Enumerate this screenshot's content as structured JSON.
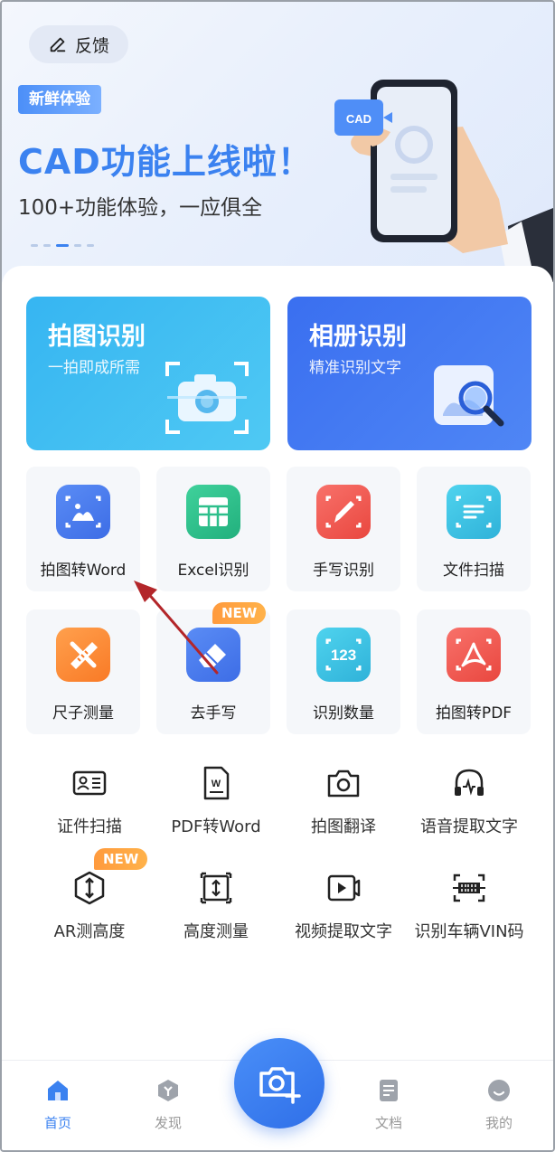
{
  "banner": {
    "feedback_label": "反馈",
    "tag": "新鲜体验",
    "title": "CAD功能上线啦！",
    "subtitle": "100+功能体验，一应俱全",
    "phone_badge": "CAD"
  },
  "big_cards": [
    {
      "title": "拍图识别",
      "subtitle": "一拍即成所需",
      "icon": "camera-scan-icon"
    },
    {
      "title": "相册识别",
      "subtitle": "精准识别文字",
      "icon": "image-search-icon"
    }
  ],
  "grid_tools": [
    {
      "label": "拍图转Word",
      "icon": "image-to-word-icon",
      "color": "#4a7cf0"
    },
    {
      "label": "Excel识别",
      "icon": "excel-table-icon",
      "color": "#2dbf8b"
    },
    {
      "label": "手写识别",
      "icon": "pen-icon",
      "color": "#f0564e"
    },
    {
      "label": "文件扫描",
      "icon": "document-scan-icon",
      "color": "#3cc0e0"
    },
    {
      "label": "尺子测量",
      "icon": "ruler-icon",
      "color": "#ff8a3c"
    },
    {
      "label": "去手写",
      "icon": "eraser-icon",
      "color": "#4a7cf0",
      "badge": "NEW"
    },
    {
      "label": "识别数量",
      "icon": "count-123-icon",
      "color": "#3cc0e0"
    },
    {
      "label": "拍图转PDF",
      "icon": "pdf-icon",
      "color": "#f0564e"
    }
  ],
  "small_tools": [
    {
      "label": "证件扫描",
      "icon": "id-card-icon"
    },
    {
      "label": "PDF转Word",
      "icon": "word-doc-icon"
    },
    {
      "label": "拍图翻译",
      "icon": "camera-translate-icon"
    },
    {
      "label": "语音提取文字",
      "icon": "headphones-icon"
    },
    {
      "label": "AR测高度",
      "icon": "ar-height-icon",
      "badge": "NEW"
    },
    {
      "label": "高度测量",
      "icon": "height-measure-icon"
    },
    {
      "label": "视频提取文字",
      "icon": "video-icon"
    },
    {
      "label": "识别车辆VIN码",
      "icon": "vin-scan-icon"
    }
  ],
  "nav": {
    "items": [
      {
        "label": "首页",
        "icon": "home-icon",
        "active": true
      },
      {
        "label": "发现",
        "icon": "discover-icon",
        "active": false
      },
      {
        "label": "文档",
        "icon": "document-icon",
        "active": false
      },
      {
        "label": "我的",
        "icon": "profile-icon",
        "active": false
      }
    ],
    "center_button_icon": "camera-plus-icon"
  },
  "colors": {
    "accent": "#3b82f0",
    "new_badge": "#ff9a3d",
    "annotation_arrow": "#b3262a"
  }
}
